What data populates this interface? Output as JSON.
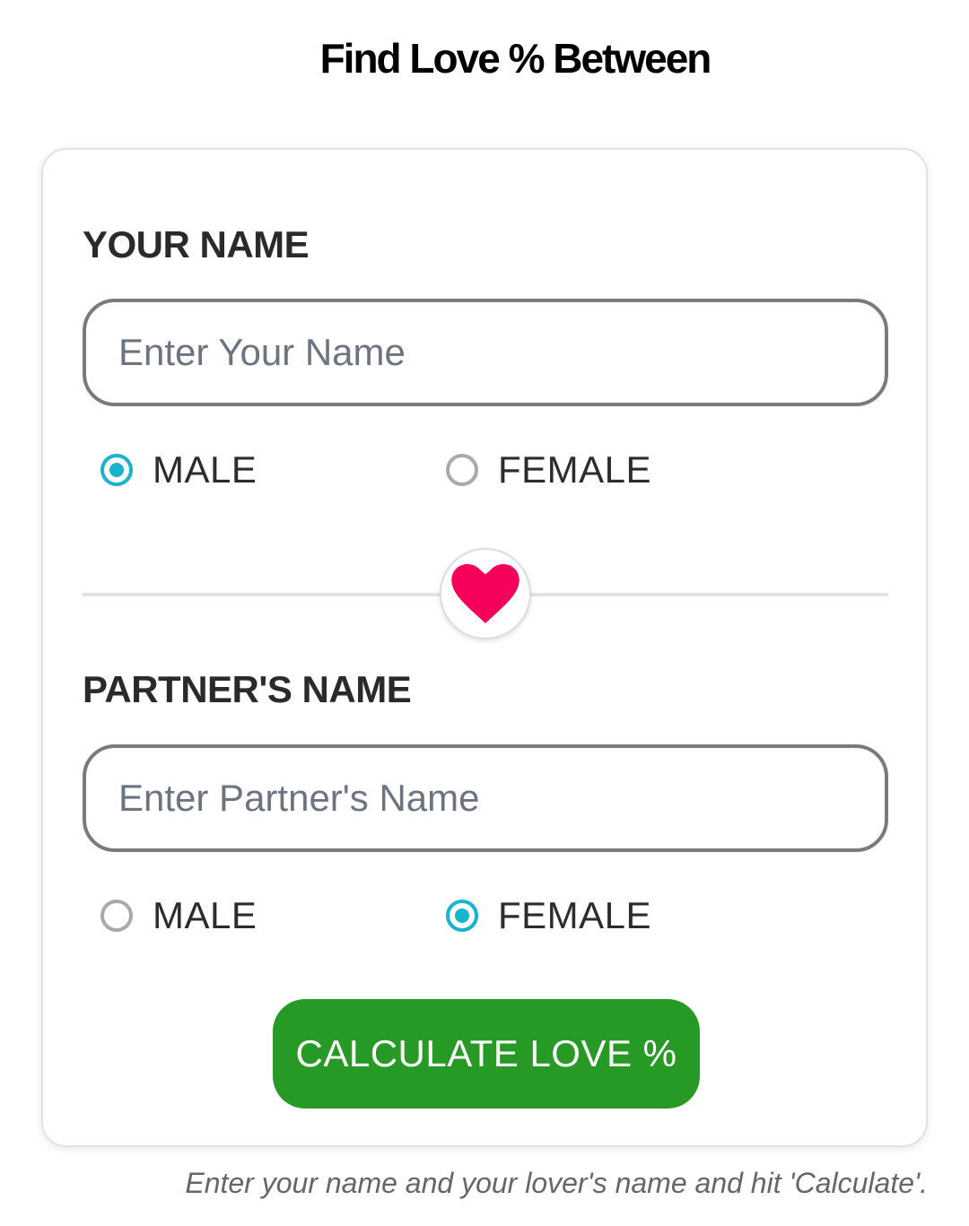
{
  "header": {
    "title": "Find Love % Between"
  },
  "form": {
    "your_name": {
      "label": "YOUR NAME",
      "placeholder": "Enter Your Name",
      "value": "",
      "gender_options": {
        "male": "MALE",
        "female": "FEMALE"
      },
      "selected_gender": "male"
    },
    "partner_name": {
      "label": "PARTNER'S NAME",
      "placeholder": "Enter Partner's Name",
      "value": "",
      "gender_options": {
        "male": "MALE",
        "female": "FEMALE"
      },
      "selected_gender": "female"
    },
    "divider_icon": "heart-icon",
    "submit_label": "CALCULATE LOVE %"
  },
  "footer": {
    "hint": "Enter your name and your lover's name and hit 'Calculate'."
  },
  "colors": {
    "accent_radio": "#18b3cf",
    "button_green": "#279a25",
    "heart_pink": "#f5005a"
  }
}
